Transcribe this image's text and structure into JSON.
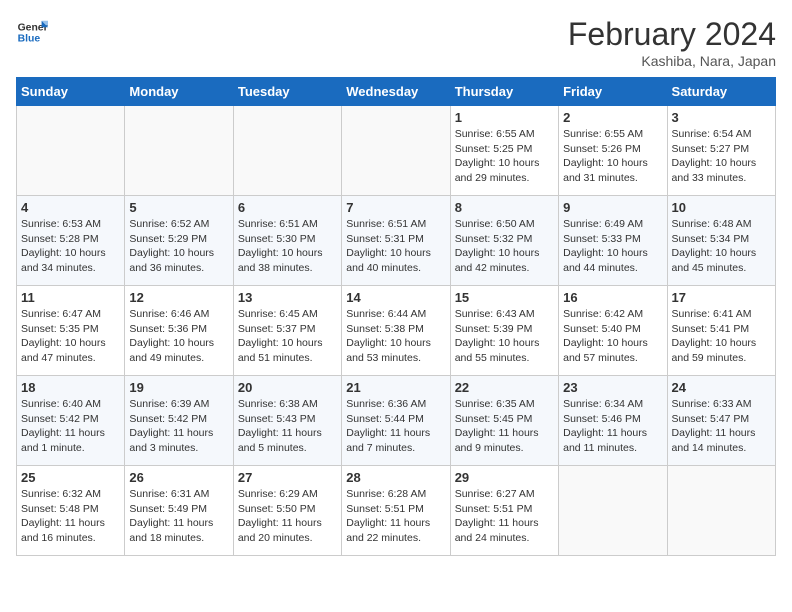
{
  "header": {
    "logo_general": "General",
    "logo_blue": "Blue",
    "title": "February 2024",
    "subtitle": "Kashiba, Nara, Japan"
  },
  "days_of_week": [
    "Sunday",
    "Monday",
    "Tuesday",
    "Wednesday",
    "Thursday",
    "Friday",
    "Saturday"
  ],
  "weeks": [
    [
      {
        "day": "",
        "info": ""
      },
      {
        "day": "",
        "info": ""
      },
      {
        "day": "",
        "info": ""
      },
      {
        "day": "",
        "info": ""
      },
      {
        "day": "1",
        "info": "Sunrise: 6:55 AM\nSunset: 5:25 PM\nDaylight: 10 hours\nand 29 minutes."
      },
      {
        "day": "2",
        "info": "Sunrise: 6:55 AM\nSunset: 5:26 PM\nDaylight: 10 hours\nand 31 minutes."
      },
      {
        "day": "3",
        "info": "Sunrise: 6:54 AM\nSunset: 5:27 PM\nDaylight: 10 hours\nand 33 minutes."
      }
    ],
    [
      {
        "day": "4",
        "info": "Sunrise: 6:53 AM\nSunset: 5:28 PM\nDaylight: 10 hours\nand 34 minutes."
      },
      {
        "day": "5",
        "info": "Sunrise: 6:52 AM\nSunset: 5:29 PM\nDaylight: 10 hours\nand 36 minutes."
      },
      {
        "day": "6",
        "info": "Sunrise: 6:51 AM\nSunset: 5:30 PM\nDaylight: 10 hours\nand 38 minutes."
      },
      {
        "day": "7",
        "info": "Sunrise: 6:51 AM\nSunset: 5:31 PM\nDaylight: 10 hours\nand 40 minutes."
      },
      {
        "day": "8",
        "info": "Sunrise: 6:50 AM\nSunset: 5:32 PM\nDaylight: 10 hours\nand 42 minutes."
      },
      {
        "day": "9",
        "info": "Sunrise: 6:49 AM\nSunset: 5:33 PM\nDaylight: 10 hours\nand 44 minutes."
      },
      {
        "day": "10",
        "info": "Sunrise: 6:48 AM\nSunset: 5:34 PM\nDaylight: 10 hours\nand 45 minutes."
      }
    ],
    [
      {
        "day": "11",
        "info": "Sunrise: 6:47 AM\nSunset: 5:35 PM\nDaylight: 10 hours\nand 47 minutes."
      },
      {
        "day": "12",
        "info": "Sunrise: 6:46 AM\nSunset: 5:36 PM\nDaylight: 10 hours\nand 49 minutes."
      },
      {
        "day": "13",
        "info": "Sunrise: 6:45 AM\nSunset: 5:37 PM\nDaylight: 10 hours\nand 51 minutes."
      },
      {
        "day": "14",
        "info": "Sunrise: 6:44 AM\nSunset: 5:38 PM\nDaylight: 10 hours\nand 53 minutes."
      },
      {
        "day": "15",
        "info": "Sunrise: 6:43 AM\nSunset: 5:39 PM\nDaylight: 10 hours\nand 55 minutes."
      },
      {
        "day": "16",
        "info": "Sunrise: 6:42 AM\nSunset: 5:40 PM\nDaylight: 10 hours\nand 57 minutes."
      },
      {
        "day": "17",
        "info": "Sunrise: 6:41 AM\nSunset: 5:41 PM\nDaylight: 10 hours\nand 59 minutes."
      }
    ],
    [
      {
        "day": "18",
        "info": "Sunrise: 6:40 AM\nSunset: 5:42 PM\nDaylight: 11 hours\nand 1 minute."
      },
      {
        "day": "19",
        "info": "Sunrise: 6:39 AM\nSunset: 5:42 PM\nDaylight: 11 hours\nand 3 minutes."
      },
      {
        "day": "20",
        "info": "Sunrise: 6:38 AM\nSunset: 5:43 PM\nDaylight: 11 hours\nand 5 minutes."
      },
      {
        "day": "21",
        "info": "Sunrise: 6:36 AM\nSunset: 5:44 PM\nDaylight: 11 hours\nand 7 minutes."
      },
      {
        "day": "22",
        "info": "Sunrise: 6:35 AM\nSunset: 5:45 PM\nDaylight: 11 hours\nand 9 minutes."
      },
      {
        "day": "23",
        "info": "Sunrise: 6:34 AM\nSunset: 5:46 PM\nDaylight: 11 hours\nand 11 minutes."
      },
      {
        "day": "24",
        "info": "Sunrise: 6:33 AM\nSunset: 5:47 PM\nDaylight: 11 hours\nand 14 minutes."
      }
    ],
    [
      {
        "day": "25",
        "info": "Sunrise: 6:32 AM\nSunset: 5:48 PM\nDaylight: 11 hours\nand 16 minutes."
      },
      {
        "day": "26",
        "info": "Sunrise: 6:31 AM\nSunset: 5:49 PM\nDaylight: 11 hours\nand 18 minutes."
      },
      {
        "day": "27",
        "info": "Sunrise: 6:29 AM\nSunset: 5:50 PM\nDaylight: 11 hours\nand 20 minutes."
      },
      {
        "day": "28",
        "info": "Sunrise: 6:28 AM\nSunset: 5:51 PM\nDaylight: 11 hours\nand 22 minutes."
      },
      {
        "day": "29",
        "info": "Sunrise: 6:27 AM\nSunset: 5:51 PM\nDaylight: 11 hours\nand 24 minutes."
      },
      {
        "day": "",
        "info": ""
      },
      {
        "day": "",
        "info": ""
      }
    ]
  ]
}
